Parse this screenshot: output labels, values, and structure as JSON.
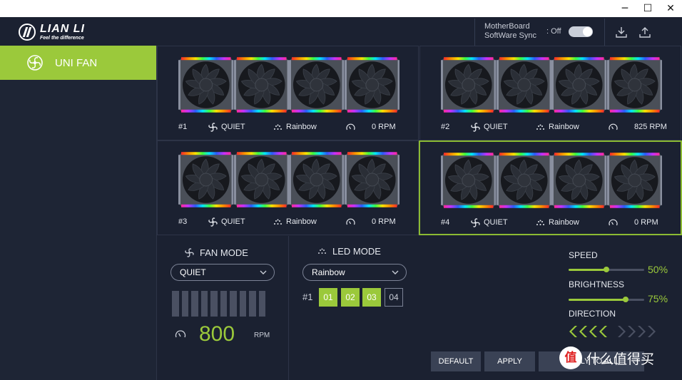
{
  "window": {
    "minimize": "─",
    "maximize": "☐",
    "close": "✕"
  },
  "header": {
    "logo_name": "LIAN LI",
    "logo_tagline": "Feel the difference",
    "mb_sync_line1": "MotherBoard",
    "mb_sync_line2": "SoftWare Sync",
    "mb_sync_state": ": Off",
    "icons": [
      "download-icon",
      "upload-icon"
    ]
  },
  "sidebar": {
    "items": [
      {
        "label": "UNI FAN",
        "icon": "fan-icon",
        "active": true
      }
    ]
  },
  "groups": [
    {
      "id": "#1",
      "mode": "QUIET",
      "led": "Rainbow",
      "rpm": "0 RPM"
    },
    {
      "id": "#2",
      "mode": "QUIET",
      "led": "Rainbow",
      "rpm": "825 RPM"
    },
    {
      "id": "#3",
      "mode": "QUIET",
      "led": "Rainbow",
      "rpm": "0 RPM"
    },
    {
      "id": "#4",
      "mode": "QUIET",
      "led": "Rainbow",
      "rpm": "0 RPM",
      "selected": true
    }
  ],
  "fan_mode": {
    "title": "FAN MODE",
    "selected": "QUIET",
    "rpm": "800",
    "rpm_unit": "RPM"
  },
  "led_mode": {
    "title": "LED MODE",
    "selected": "Rainbow",
    "group_label": "#1",
    "zones": [
      {
        "label": "01",
        "on": true
      },
      {
        "label": "02",
        "on": true
      },
      {
        "label": "03",
        "on": true
      },
      {
        "label": "04",
        "on": false
      }
    ]
  },
  "controls": {
    "speed_label": "SPEED",
    "speed_value": "50%",
    "speed_level": 0.5,
    "brightness_label": "BRIGHTNESS",
    "brightness_value": "75%",
    "brightness_level": 0.75,
    "direction_label": "DIRECTION",
    "direction_active": "left"
  },
  "buttons": {
    "default": "DEFAULT",
    "apply": "APPLY",
    "apply_all": "APPLY TO ALL"
  },
  "watermark": {
    "logo": "值",
    "text": "什么值得买"
  },
  "colors": {
    "accent": "#9bc93b",
    "background": "#1b2131",
    "panel": "#1e2535"
  }
}
